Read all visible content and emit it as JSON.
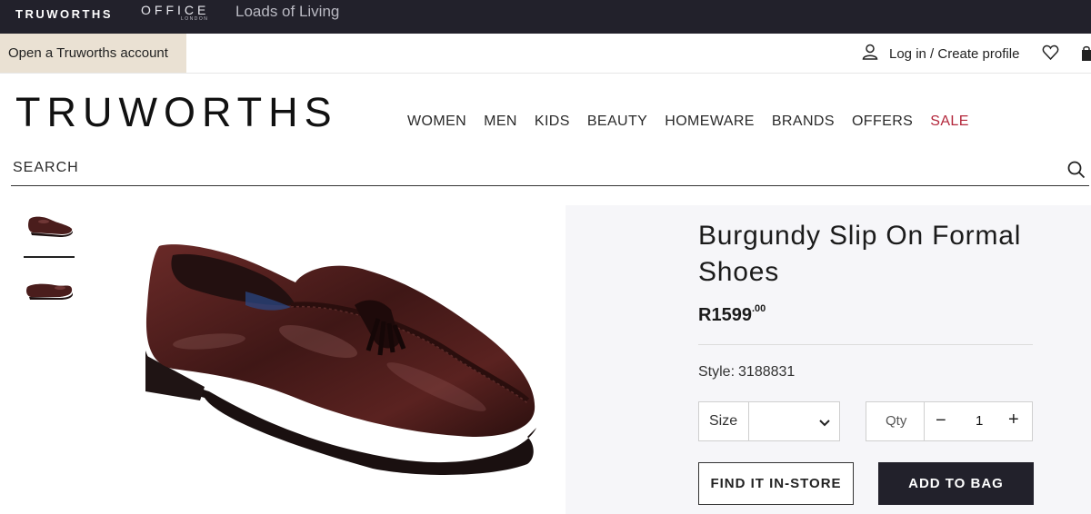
{
  "brand_bar": {
    "truworths": "TRUWORTHS",
    "office": "OFFICE",
    "office_sub": "LONDON",
    "loads_of_living": "Loads of Living"
  },
  "account_bar": {
    "open_account": "Open a Truworths account",
    "login": "Log in / Create profile"
  },
  "header": {
    "logo": "TRUWORTHS",
    "nav": [
      "WOMEN",
      "MEN",
      "KIDS",
      "BEAUTY",
      "HOMEWARE",
      "BRANDS",
      "OFFERS",
      "SALE"
    ],
    "sale_color": "#b3273b"
  },
  "search": {
    "label": "SEARCH",
    "icon": "search-icon"
  },
  "product": {
    "title": "Burgundy Slip On Formal Shoes",
    "price_main": "R1599",
    "price_cents": ".00",
    "style_label": "Style:",
    "style_value": "3188831",
    "size_label": "Size",
    "qty_label": "Qty",
    "qty_minus": "−",
    "qty_value": "1",
    "qty_plus": "+",
    "find_in_store": "FIND IT IN-STORE",
    "add_to_bag": "ADD TO BAG",
    "thumbnail_count": 2
  },
  "colors": {
    "dark": "#22212b",
    "account_bg": "#eae1d3",
    "gallery_bg": "#f6f6f9",
    "shoe": "#4a1d1c"
  }
}
